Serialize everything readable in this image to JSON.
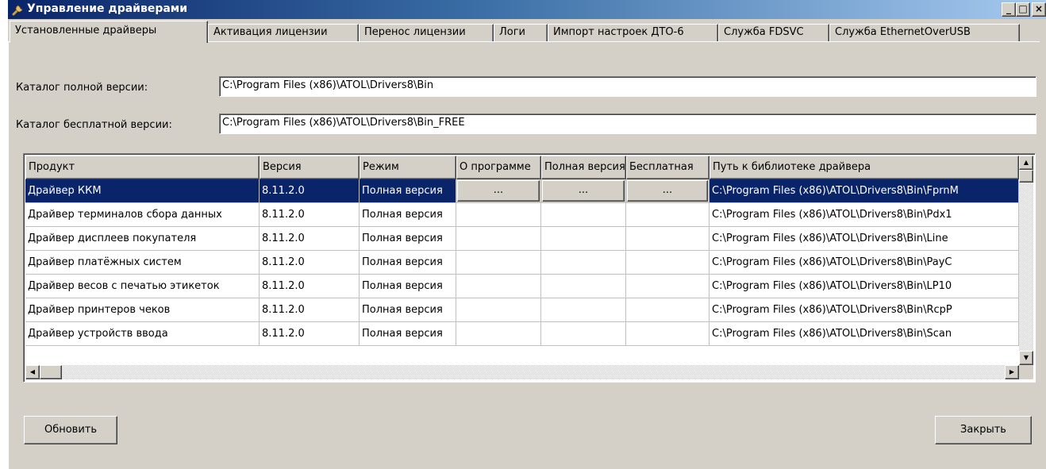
{
  "window": {
    "title": "Управление драйверами",
    "minimize_label": "_",
    "maximize_label": "□",
    "close_label": "×"
  },
  "tabs": [
    {
      "label": "Установленные драйверы",
      "active": true
    },
    {
      "label": "Активация лицензии"
    },
    {
      "label": "Перенос лицензии"
    },
    {
      "label": "Логи"
    },
    {
      "label": "Импорт настроек ДТО-6"
    },
    {
      "label": "Служба FDSVC"
    },
    {
      "label": "Служба EthernetOverUSB"
    }
  ],
  "full_dir": {
    "label": "Каталог полной версии:",
    "value": "C:\\Program Files (x86)\\ATOL\\Drivers8\\Bin"
  },
  "free_dir": {
    "label": "Каталог бесплатной версии:",
    "value": "C:\\Program Files (x86)\\ATOL\\Drivers8\\Bin_FREE"
  },
  "grid": {
    "columns": [
      "Продукт",
      "Версия",
      "Режим",
      "О программе",
      "Полная версия",
      "Бесплатная",
      "Путь к библиотеке драйвера"
    ],
    "ellipsis": "...",
    "rows": [
      {
        "product": "Драйвер ККМ",
        "version": "8.11.2.0",
        "mode": "Полная версия",
        "path": "C:\\Program Files (x86)\\ATOL\\Drivers8\\Bin\\FprnM",
        "selected": true
      },
      {
        "product": "Драйвер терминалов сбора данных",
        "version": "8.11.2.0",
        "mode": "Полная версия",
        "path": "C:\\Program Files (x86)\\ATOL\\Drivers8\\Bin\\Pdx1"
      },
      {
        "product": "Драйвер дисплеев покупателя",
        "version": "8.11.2.0",
        "mode": "Полная версия",
        "path": "C:\\Program Files (x86)\\ATOL\\Drivers8\\Bin\\Line"
      },
      {
        "product": "Драйвер платёжных систем",
        "version": "8.11.2.0",
        "mode": "Полная версия",
        "path": "C:\\Program Files (x86)\\ATOL\\Drivers8\\Bin\\PayC"
      },
      {
        "product": "Драйвер весов с печатью этикеток",
        "version": "8.11.2.0",
        "mode": "Полная версия",
        "path": "C:\\Program Files (x86)\\ATOL\\Drivers8\\Bin\\LP10"
      },
      {
        "product": "Драйвер принтеров чеков",
        "version": "8.11.2.0",
        "mode": "Полная версия",
        "path": "C:\\Program Files (x86)\\ATOL\\Drivers8\\Bin\\RcpP"
      },
      {
        "product": "Драйвер устройств ввода",
        "version": "8.11.2.0",
        "mode": "Полная версия",
        "path": "C:\\Program Files (x86)\\ATOL\\Drivers8\\Bin\\Scan"
      }
    ]
  },
  "buttons": {
    "refresh": "Обновить",
    "close": "Закрыть"
  },
  "colors": {
    "selection": "#0a246a",
    "face": "#d4d0c8",
    "title_gradient_start": "#0a246a",
    "title_gradient_end": "#a6caf0"
  }
}
